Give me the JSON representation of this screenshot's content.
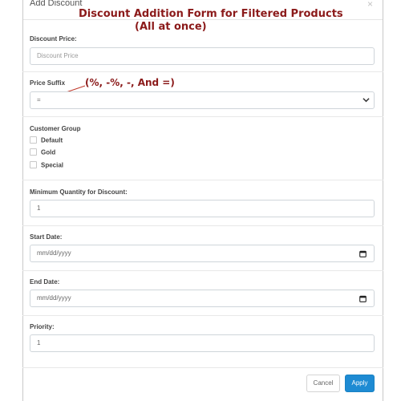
{
  "modal": {
    "title": "Add Discount",
    "close_symbol": "×"
  },
  "annotations": {
    "title_line1": "Discount Addition Form for Filtered Products",
    "title_line2": "(All at once)",
    "suffix_note": "(%, -%, -, And =)"
  },
  "form": {
    "discount_price": {
      "label": "Discount Price:",
      "placeholder": "Discount Price"
    },
    "price_suffix": {
      "label": "Price Suffix",
      "value": "="
    },
    "customer_group": {
      "label": "Customer Group",
      "options": [
        "Default",
        "Gold",
        "Special"
      ]
    },
    "min_quantity": {
      "label": "Minimum Quantity for Discount:",
      "value": "1"
    },
    "start_date": {
      "label": "Start Date:",
      "placeholder": "mm/dd/yyyy"
    },
    "end_date": {
      "label": "End Date:",
      "placeholder": "mm/dd/yyyy"
    },
    "priority": {
      "label": "Priority:",
      "value": "1"
    }
  },
  "footer": {
    "cancel_label": "Cancel",
    "apply_label": "Apply"
  },
  "colors": {
    "apply_button": "#1e8bd3",
    "annotation_text": "#8b1a1a"
  }
}
